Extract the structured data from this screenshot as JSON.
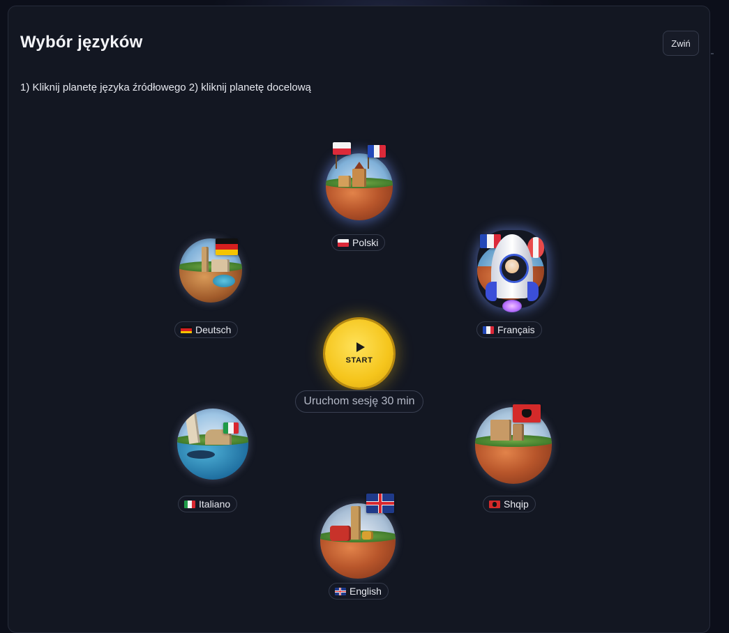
{
  "header": {
    "title": "Wybór języków",
    "collapse_label": "Zwiń"
  },
  "instruction": "1) Kliknij planetę języka źródłowego 2) kliknij planetę docelową",
  "start": {
    "label": "START",
    "session_label": "Uruchom sesję 30 min"
  },
  "languages": [
    {
      "name": "Polski",
      "flag": "flag-pl-icon",
      "selected": true
    },
    {
      "name": "Deutsch",
      "flag": "flag-de-icon",
      "selected": false
    },
    {
      "name": "Français",
      "flag": "flag-fr-icon",
      "selected": true
    },
    {
      "name": "Italiano",
      "flag": "flag-it-icon",
      "selected": false
    },
    {
      "name": "Shqip",
      "flag": "flag-al-icon",
      "selected": false
    },
    {
      "name": "English",
      "flag": "flag-gb-icon",
      "selected": false
    }
  ],
  "colors": {
    "background": "#0c0f1a",
    "panel": "#131722",
    "accent_start": "#f5c51c",
    "selection_glow": "#7896ff"
  }
}
